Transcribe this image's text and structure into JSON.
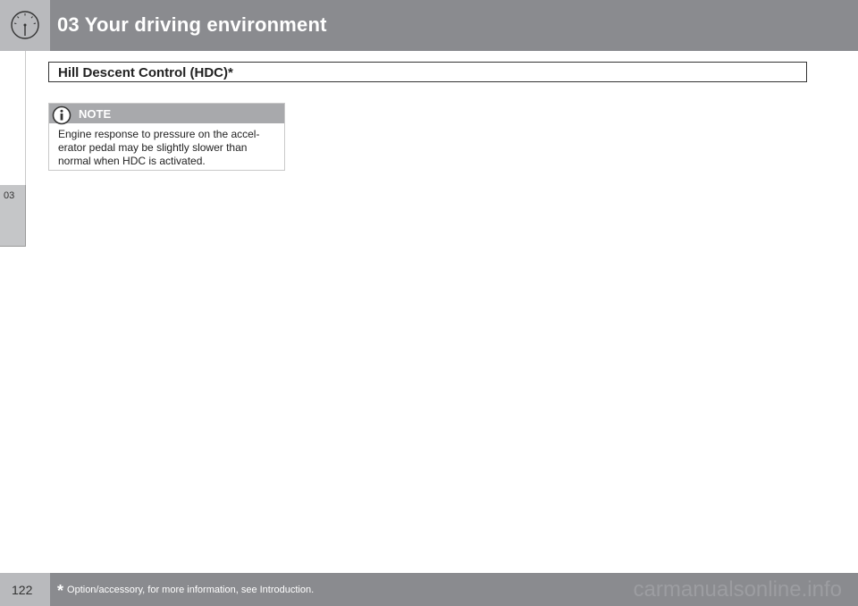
{
  "header": {
    "chapter_title": "03 Your driving environment",
    "icon": "speedometer-icon"
  },
  "side_tab": {
    "label": "03"
  },
  "section": {
    "title": "Hill Descent Control (HDC)*"
  },
  "note": {
    "icon": "info-icon",
    "label": "NOTE",
    "lines": [
      "Engine response to pressure on the accel-",
      "erator pedal may be slightly slower than",
      "normal when HDC is activated."
    ]
  },
  "footer": {
    "page_number": "122",
    "asterisk": "*",
    "note": "Option/accessory, for more information, see Introduction."
  },
  "watermark": "carmanualsonline.info",
  "colors": {
    "header_bar": "#8a8b8f",
    "icon_tile": "#b9babd",
    "side_tab": "#c5c6c8",
    "note_header": "#a8a9ac"
  }
}
